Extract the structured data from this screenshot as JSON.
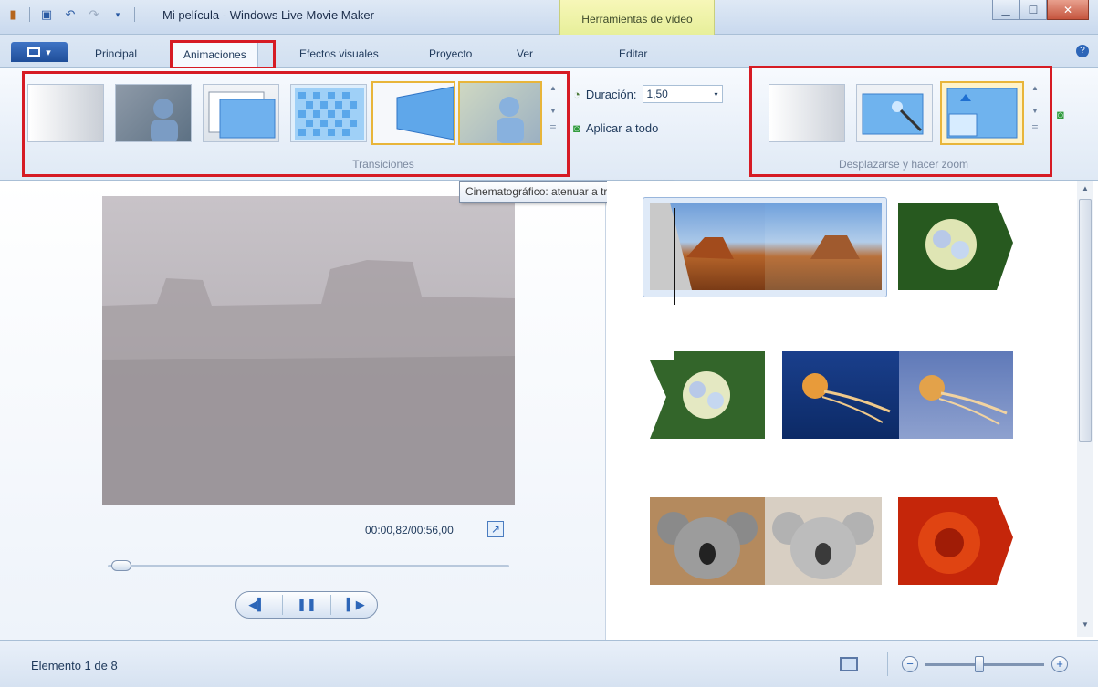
{
  "title_bar": {
    "app_title": "Mi película - Windows Live Movie Maker",
    "context_tab_header": "Herramientas de vídeo"
  },
  "tabs": [
    {
      "label": "Principal"
    },
    {
      "label": "Animaciones"
    },
    {
      "label": "Efectos visuales"
    },
    {
      "label": "Proyecto"
    },
    {
      "label": "Ver"
    },
    {
      "label": "Editar"
    }
  ],
  "ribbon": {
    "transitions_label": "Transiciones",
    "duration_label": "Duración:",
    "duration_value": "1,50",
    "apply_all_label": "Aplicar a todo",
    "pan_zoom_label": "Desplazarse y hacer zoom"
  },
  "tooltip": "Cinematográfico: atenuar a través de gris",
  "preview": {
    "timecode": "00:00,82/00:56,00",
    "seek_progress": 0.015
  },
  "status": {
    "item_count": "Elemento 1 de 8",
    "zoom_level": 0.45
  },
  "colors": {
    "highlight_red": "#d61b24",
    "selection_gold": "#e8b53a",
    "accent_blue": "#2d66b8"
  }
}
